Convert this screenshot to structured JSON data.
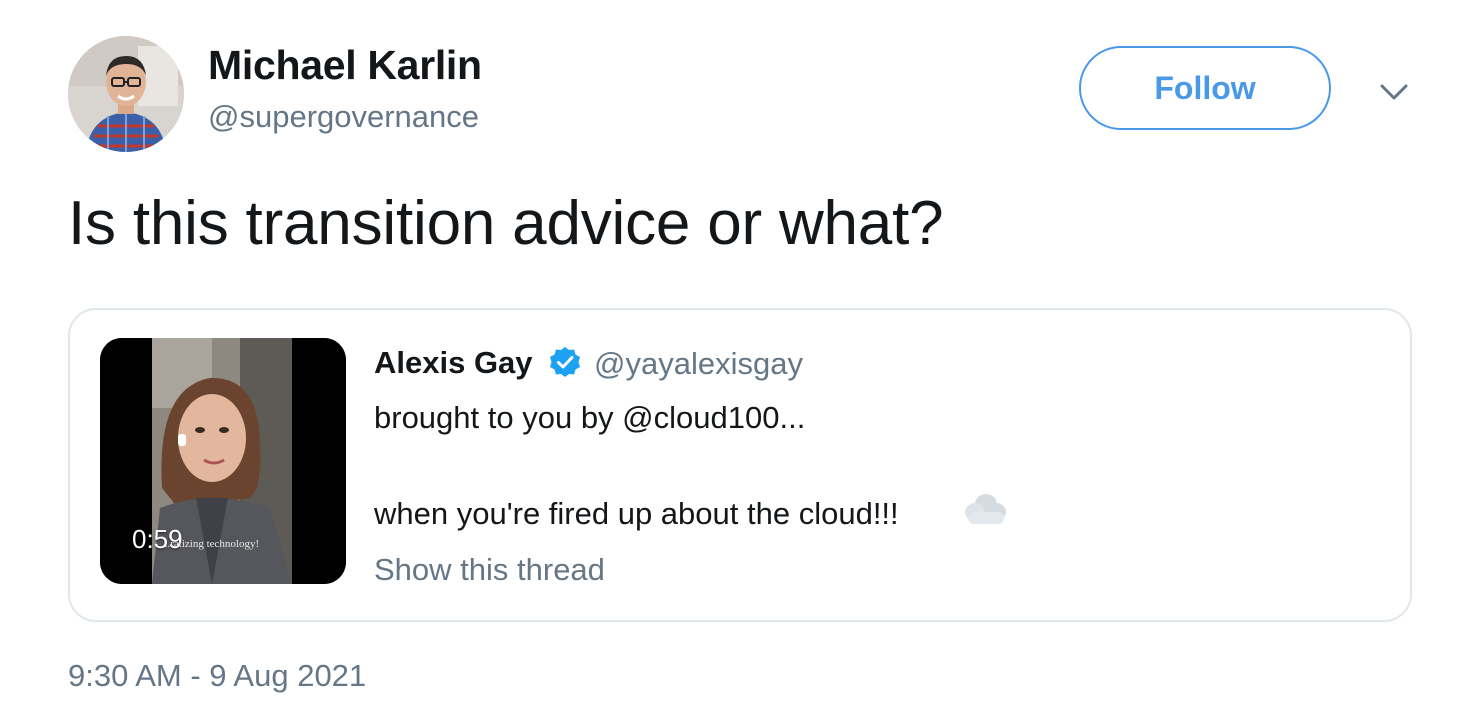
{
  "author": {
    "name": "Michael Karlin",
    "handle": "@supergovernance",
    "avatar_icon": "person-avatar-icon"
  },
  "actions": {
    "follow_label": "Follow",
    "more_icon": "chevron-down-icon"
  },
  "tweet": {
    "text": "Is this transition advice or what?",
    "timestamp": "9:30 AM - 9 Aug 2021"
  },
  "quoted": {
    "name": "Alexis Gay",
    "handle": "@yayalexisgay",
    "verified": true,
    "line1": "brought to you by @cloud100...",
    "line2": "when you're fired up about the cloud!!!",
    "emoji_icon": "cloud-icon",
    "show_thread": "Show this thread",
    "video": {
      "duration": "0:59",
      "caption": "...ratizing technology!"
    }
  },
  "colors": {
    "accent": "#4a99e9",
    "text": "#14171a",
    "muted": "#657786",
    "border": "#e1e8ed",
    "verified": "#1da1f2"
  }
}
